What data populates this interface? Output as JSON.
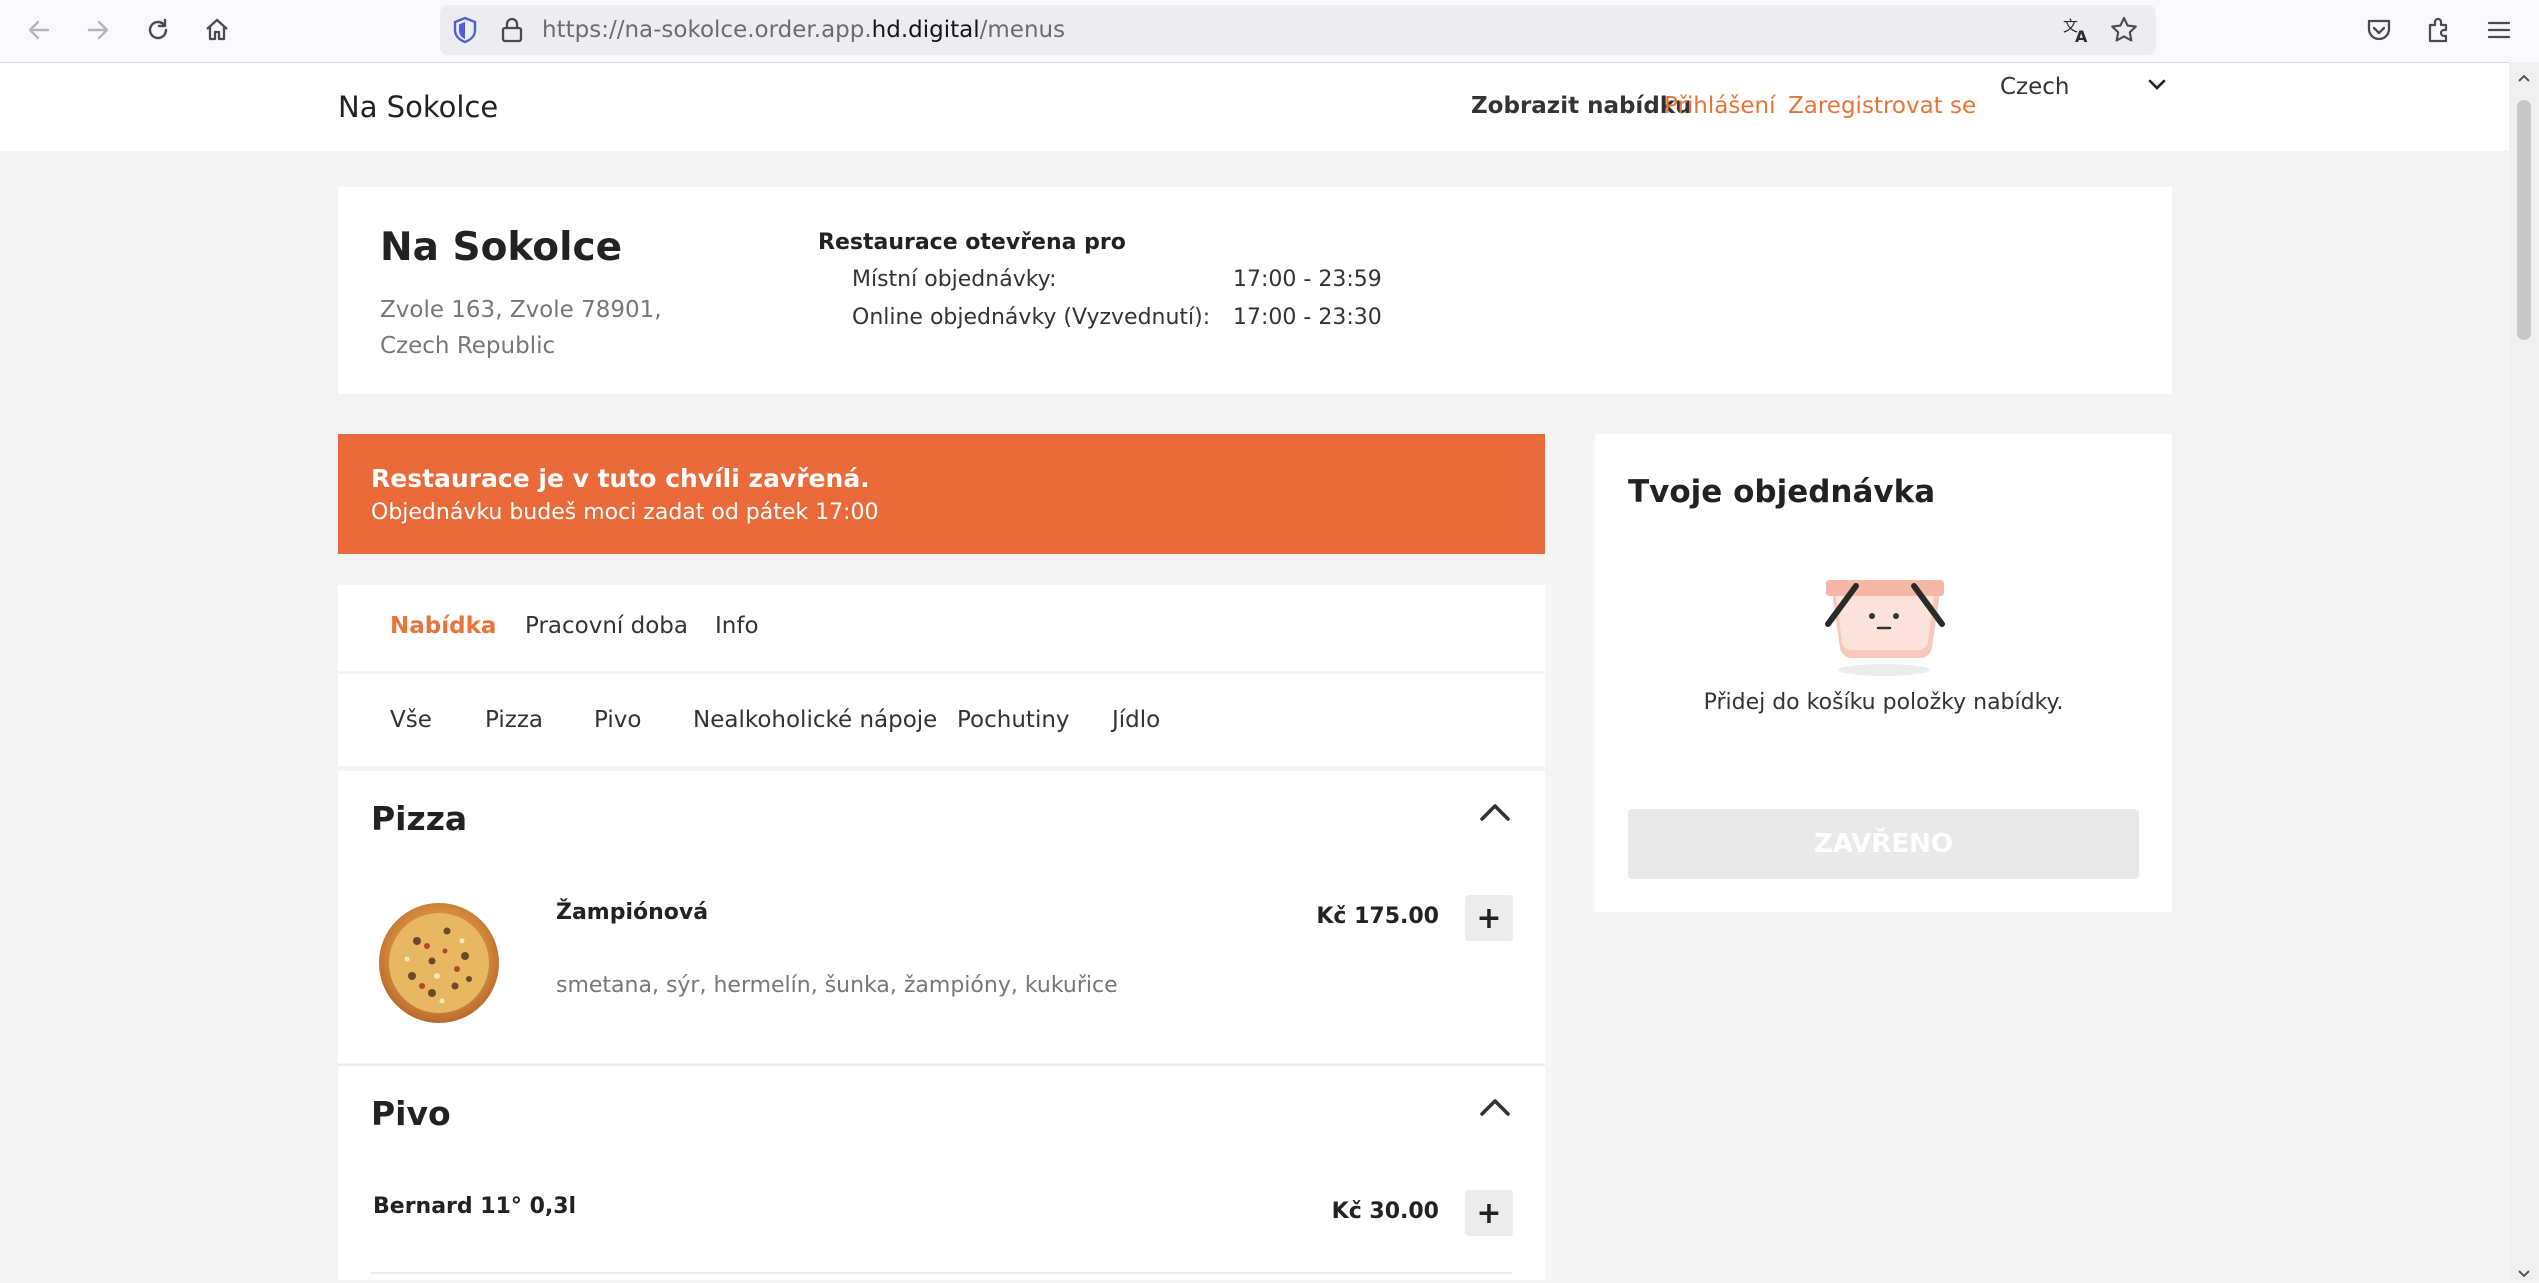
{
  "browser": {
    "url_prefix": "https://na-sokolce.order.app.",
    "url_domain": "hd.digital",
    "url_suffix": "/menus"
  },
  "header": {
    "brand": "Na Sokolce",
    "nav_menu": "Zobrazit nabídku",
    "nav_login": "Přihlášení",
    "nav_register": "Zaregistrovat se",
    "language": "Czech"
  },
  "restaurant": {
    "name": "Na Sokolce",
    "address": "Zvole 163, Zvole 78901, Czech Republic",
    "open_title": "Restaurace otevřena pro",
    "hours": [
      {
        "label": "Místní objednávky:",
        "value": "17:00 - 23:59"
      },
      {
        "label": "Online objednávky (Vyzvednutí):",
        "value": "17:00 - 23:30"
      }
    ]
  },
  "banner": {
    "title": "Restaurace je v tuto chvíli zavřená.",
    "subtitle": "Objednávku budeš moci zadat od pátek 17:00"
  },
  "tabs": [
    "Nabídka",
    "Pracovní doba",
    "Info"
  ],
  "categories": [
    "Vše",
    "Pizza",
    "Pivo",
    "Nealkoholické nápoje",
    "Pochutiny",
    "Jídlo"
  ],
  "sections": [
    {
      "title": "Pizza",
      "items": [
        {
          "name": "Žampiónová",
          "description": "smetana, sýr, hermelín, šunka, žampióny, kukuřice",
          "price": "Kč 175.00",
          "add": "+"
        }
      ]
    },
    {
      "title": "Pivo",
      "items": [
        {
          "name": "Bernard 11° 0,3l",
          "price": "Kč 30.00",
          "add": "+"
        }
      ]
    }
  ],
  "order": {
    "title": "Tvoje objednávka",
    "empty_text": "Přidej do košíku položky nabídky.",
    "button": "ZAVŘENO"
  },
  "colors": {
    "accent": "#e8743b",
    "banner": "#ea6b39",
    "background": "#f4f4f4"
  }
}
